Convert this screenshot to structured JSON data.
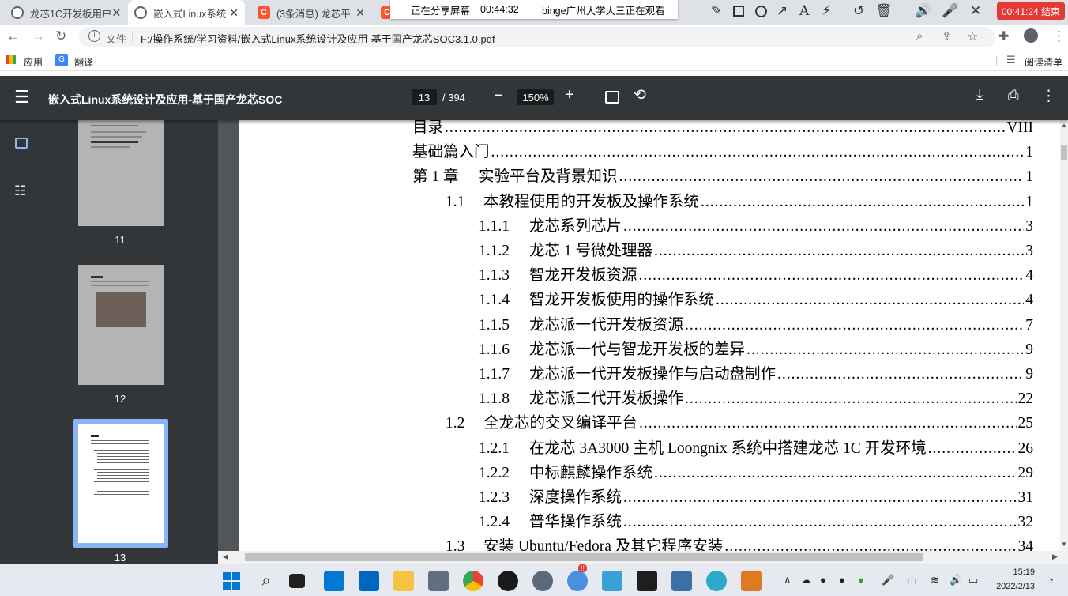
{
  "tabs": [
    {
      "title": "龙芯1C开发板用户",
      "icon": "globe-icon"
    },
    {
      "title": "嵌入式Linux系统",
      "icon": "globe-icon",
      "active": true
    },
    {
      "title": "(3条消息) 龙芯平",
      "icon": "csdn-icon"
    },
    {
      "title": "",
      "icon": "csdn-icon"
    }
  ],
  "share": {
    "status": "正在分享屏幕",
    "timer": "00:44:32",
    "viewer": "binge广州大学大三正在观看"
  },
  "record": {
    "end_label": "00:41:24 结束"
  },
  "address": {
    "label": "文件",
    "url": "F:/操作系统/学习资料/嵌入式Linux系统设计及应用-基于国产龙芯SOC3.1.0.pdf"
  },
  "bookmarks": {
    "apps": "应用",
    "translate": "翻译",
    "reading_list": "阅读清单"
  },
  "pdf": {
    "title": "嵌入式Linux系统设计及应用-基于国产龙芯SOC",
    "page": "13",
    "total": "/ 394",
    "zoom": "150%"
  },
  "thumbs": [
    {
      "label": "11"
    },
    {
      "label": "12"
    },
    {
      "label": "13"
    }
  ],
  "toc": [
    {
      "num": "目录",
      "title": "",
      "page": "VIII",
      "level": 0
    },
    {
      "num": "基础篇入门",
      "title": "",
      "page": "1",
      "level": 0
    },
    {
      "num": "第 1 章",
      "title": "实验平台及背景知识",
      "page": "1",
      "level": 0
    },
    {
      "num": "1.1",
      "title": "本教程使用的开发板及操作系统",
      "page": "1",
      "level": 1
    },
    {
      "num": "1.1.1",
      "title": "龙芯系列芯片",
      "page": "3",
      "level": 2
    },
    {
      "num": "1.1.2",
      "title": "龙芯 1 号微处理器",
      "page": "3",
      "level": 2
    },
    {
      "num": "1.1.3",
      "title": "智龙开发板资源",
      "page": "4",
      "level": 2
    },
    {
      "num": "1.1.4",
      "title": "智龙开发板使用的操作系统",
      "page": "4",
      "level": 2
    },
    {
      "num": "1.1.5",
      "title": "龙芯派一代开发板资源",
      "page": "7",
      "level": 2
    },
    {
      "num": "1.1.6",
      "title": "龙芯派一代与智龙开发板的差异",
      "page": "9",
      "level": 2
    },
    {
      "num": "1.1.7",
      "title": "龙芯派一代开发板操作与启动盘制作",
      "page": "9",
      "level": 2
    },
    {
      "num": "1.1.8",
      "title": "龙芯派二代开发板操作",
      "page": "22",
      "level": 2
    },
    {
      "num": "1.2",
      "title": "全龙芯的交叉编译平台",
      "page": "25",
      "level": 1
    },
    {
      "num": "1.2.1",
      "title": "在龙芯 3A3000 主机 Loongnix 系统中搭建龙芯 1C 开发环境",
      "page": "26",
      "level": 2
    },
    {
      "num": "1.2.2",
      "title": "中标麒麟操作系统",
      "page": "29",
      "level": 2
    },
    {
      "num": "1.2.3",
      "title": "深度操作系统",
      "page": "31",
      "level": 2
    },
    {
      "num": "1.2.4",
      "title": "普华操作系统",
      "page": "32",
      "level": 2
    },
    {
      "num": "1.3",
      "title": "安装 Ubuntu/Fedora 及其它程序安装",
      "page": "34",
      "level": 1
    }
  ],
  "taskbar": {
    "ime": "中",
    "time": "15:19",
    "date": "2022/2/13",
    "badge": "!!"
  }
}
